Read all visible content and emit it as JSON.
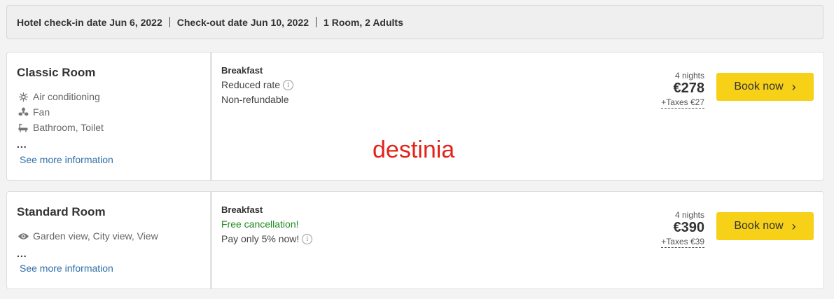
{
  "summary": {
    "checkin": "Hotel check-in date Jun 6, 2022",
    "checkout": "Check-out date Jun 10, 2022",
    "occupancy": "1 Room, 2 Adults"
  },
  "rooms": [
    {
      "title": "Classic Room",
      "amenities": [
        {
          "icon": "snowflake-icon",
          "label": "Air conditioning"
        },
        {
          "icon": "fan-icon",
          "label": "Fan"
        },
        {
          "icon": "bathtub-icon",
          "label": "Bathroom, Toilet"
        }
      ],
      "ellipsis": "...",
      "more_link": "See more information",
      "board": "Breakfast",
      "line1": "Reduced rate",
      "line2": "Non-refundable",
      "nights": "4 nights",
      "price": "€278",
      "taxes": "+Taxes €27",
      "book_label": "Book now"
    },
    {
      "title": "Standard Room",
      "amenities": [
        {
          "icon": "eye-icon",
          "label": "Garden view, City view, View"
        }
      ],
      "ellipsis": "...",
      "more_link": "See more information",
      "board": "Breakfast",
      "line1": "Free cancellation!",
      "line2": "Pay only 5% now!",
      "nights": "4 nights",
      "price": "€390",
      "taxes": "+Taxes €39",
      "book_label": "Book now"
    }
  ],
  "watermark": "destinia",
  "colors": {
    "book_button": "#f7d018",
    "link": "#2d6ea8",
    "free_cancellation": "#1d8a1d",
    "watermark": "#e2231a"
  }
}
